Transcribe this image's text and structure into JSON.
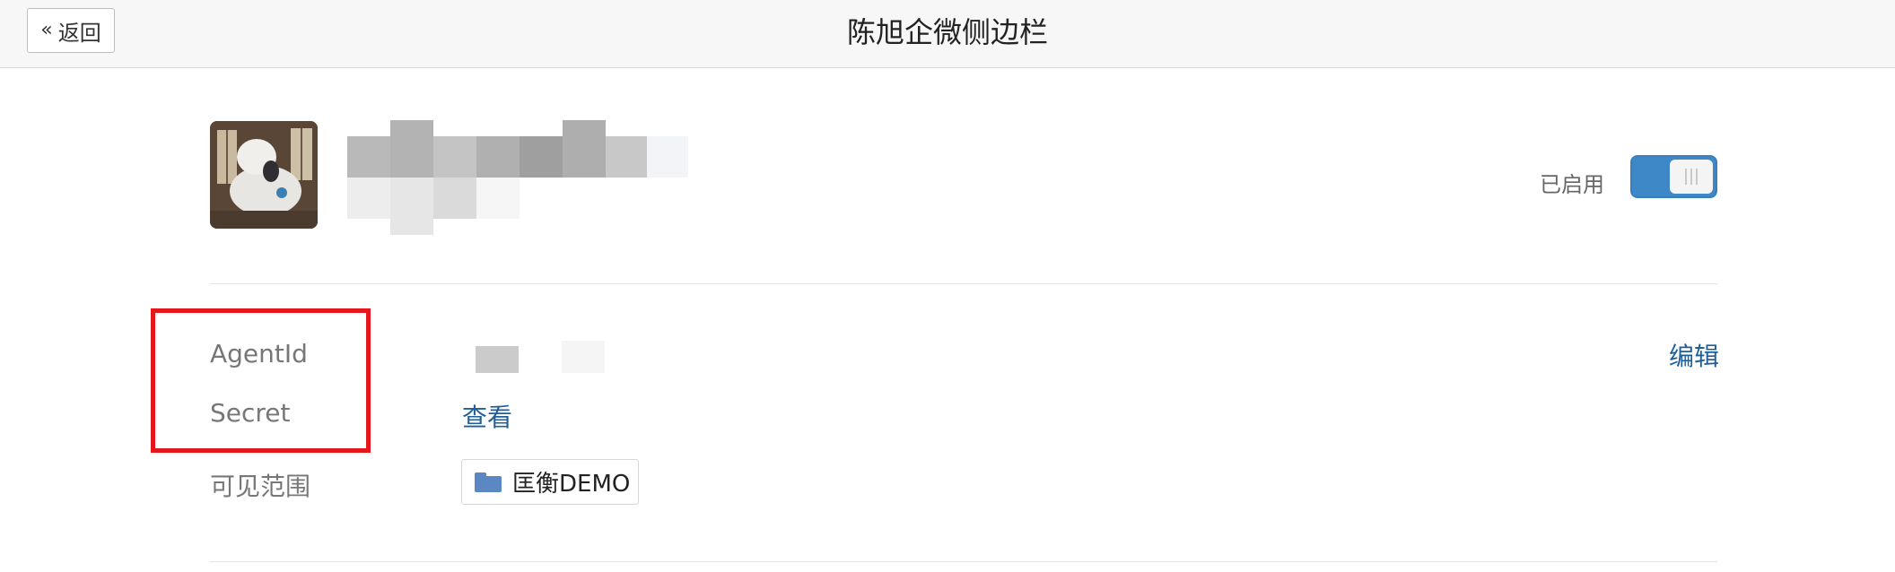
{
  "header": {
    "back_label": "返回",
    "back_icon": "double-chevron-left-icon",
    "title": "陈旭企微侧边栏"
  },
  "app": {
    "status_label": "已启用",
    "enabled": true
  },
  "fields": {
    "agentid_label": "AgentId",
    "secret_label": "Secret",
    "scope_label": "可见范围",
    "edit_label": "编辑",
    "view_label": "查看",
    "scope_value": "匡衡DEMO",
    "scope_icon": "folder-icon"
  },
  "colors": {
    "accent": "#3f88c8",
    "link": "#1f5f99",
    "highlight": "#e4171c"
  }
}
